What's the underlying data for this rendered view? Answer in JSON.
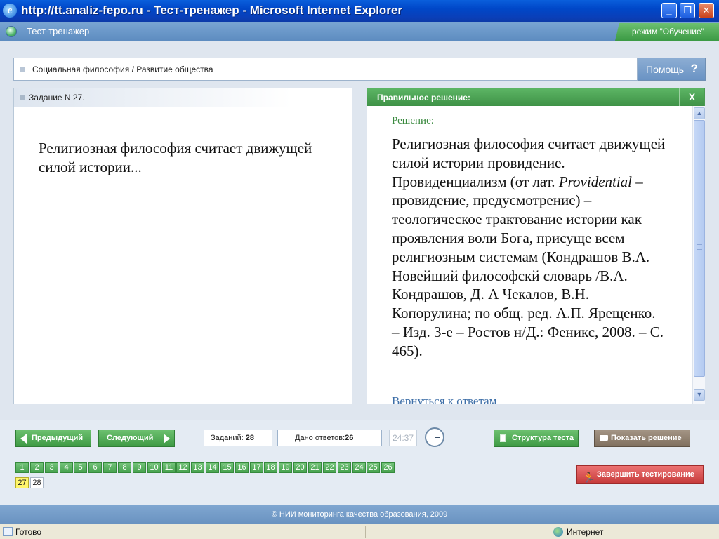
{
  "window": {
    "title": "http://tt.analiz-fepo.ru - Тест-тренажер - Microsoft Internet Explorer",
    "minimize": "_",
    "maximize": "❐",
    "close": "✕"
  },
  "header": {
    "app_title": "Тест-тренажер",
    "mode": "режим \"Обучение\""
  },
  "breadcrumb": "Социальная философия / Развитие общества",
  "help": {
    "label": "Помощь",
    "icon": "?"
  },
  "task": {
    "number_label": "Задание N 27.",
    "question": "Религиозная философия считает движущей силой истории..."
  },
  "solution": {
    "header": "Правильное решение:",
    "close": "X",
    "subtitle": "Решение:",
    "text_before_italic": "Религиозная философия считает движущей силой истории провидение. Провиденциализм (от лат. ",
    "italic": "Providential",
    "text_after_italic": " – провидение, предусмотрение) – теологическое трактование истории как проявления воли Бога, присуще всем религиозным системам (Кондрашов В.А. Новейший философскй словарь /В.А. Кондрашов, Д. А Чекалов, В.Н. Копорулина; по общ. ред. А.П. Ярещенко. – Изд. 3-е – Ростов н/Д.: Феникс, 2008. – С. 465).",
    "back_link": "Вернуться к ответам"
  },
  "controls": {
    "prev": "Предыдущий",
    "next": "Следующий",
    "tasks_label": "Заданий:",
    "tasks_count": "28",
    "answers_label": "Дано ответов:",
    "answers_count": "26",
    "timer": "24:37",
    "structure": "Структура теста",
    "show_solution": "Показать решение",
    "finish": "Завершить тестирование"
  },
  "task_numbers": {
    "answered": [
      "1",
      "2",
      "3",
      "4",
      "5",
      "6",
      "7",
      "8",
      "9",
      "10",
      "11",
      "12",
      "13",
      "14",
      "15",
      "16",
      "17",
      "18",
      "19",
      "20",
      "21",
      "22",
      "23",
      "24",
      "25",
      "26"
    ],
    "current": "27",
    "unanswered": [
      "28"
    ]
  },
  "footer": "© НИИ мониторинга качества образования, 2009",
  "statusbar": {
    "status": "Готово",
    "zone": "Интернет"
  },
  "colors": {
    "accent_green": "#47a24e",
    "current_yellow": "#fff66c",
    "finish_red": "#c73c3c",
    "title_blue": "#0047c8"
  }
}
